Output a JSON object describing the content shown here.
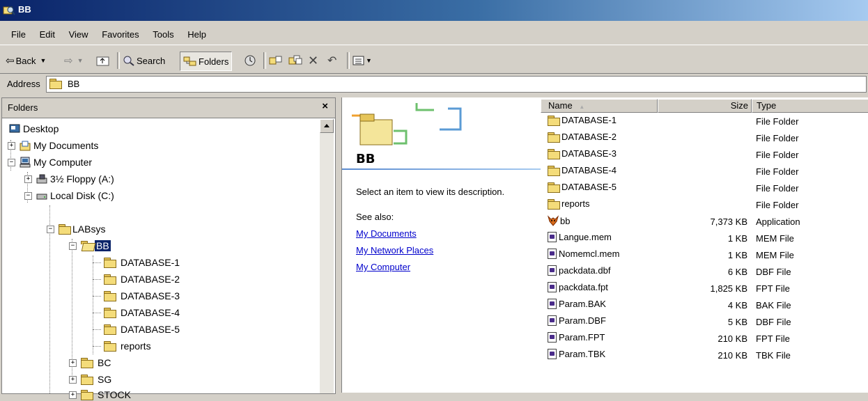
{
  "window": {
    "title": "BB"
  },
  "menu": [
    "File",
    "Edit",
    "View",
    "Favorites",
    "Tools",
    "Help"
  ],
  "toolbar": {
    "back_label": "Back",
    "search_label": "Search",
    "folders_label": "Folders"
  },
  "address": {
    "label": "Address",
    "value": "BB"
  },
  "folders_pane": {
    "title": "Folders",
    "close_glyph": "×",
    "tree": [
      {
        "label": "Desktop",
        "icon": "desktop-icon"
      },
      {
        "label": "My Documents",
        "icon": "my-documents-icon",
        "toggle": "+"
      },
      {
        "label": "My Computer",
        "icon": "my-computer-icon",
        "toggle": "−"
      },
      {
        "label": "3½ Floppy (A:)",
        "icon": "floppy-drive-icon",
        "toggle": "+"
      },
      {
        "label": "Local Disk (C:)",
        "icon": "hard-disk-icon",
        "toggle": "−"
      },
      {
        "label": "LABsys",
        "icon": "folder-icon",
        "toggle": "−"
      },
      {
        "label": "BB",
        "icon": "folder-open-icon",
        "toggle": "−",
        "selected": true
      },
      {
        "label": "DATABASE-1",
        "icon": "folder-icon"
      },
      {
        "label": "DATABASE-2",
        "icon": "folder-icon"
      },
      {
        "label": "DATABASE-3",
        "icon": "folder-icon"
      },
      {
        "label": "DATABASE-4",
        "icon": "folder-icon"
      },
      {
        "label": "DATABASE-5",
        "icon": "folder-icon"
      },
      {
        "label": "reports",
        "icon": "folder-icon"
      },
      {
        "label": "BC",
        "icon": "folder-icon",
        "toggle": "+"
      },
      {
        "label": "SG",
        "icon": "folder-icon",
        "toggle": "+"
      },
      {
        "label": "STOCK",
        "icon": "folder-icon",
        "toggle": "+"
      }
    ]
  },
  "web_view": {
    "folder_name": "BB",
    "description": "Select an item to view its description.",
    "see_also": "See also:",
    "links": [
      "My Documents",
      "My Network Places",
      "My Computer"
    ]
  },
  "list": {
    "columns": {
      "name": "Name",
      "size": "Size",
      "type": "Type"
    },
    "sort_glyph": "▲",
    "files": [
      {
        "name": "DATABASE-1",
        "size": "",
        "type": "File Folder",
        "icon": "folder-icon"
      },
      {
        "name": "DATABASE-2",
        "size": "",
        "type": "File Folder",
        "icon": "folder-icon"
      },
      {
        "name": "DATABASE-3",
        "size": "",
        "type": "File Folder",
        "icon": "folder-icon"
      },
      {
        "name": "DATABASE-4",
        "size": "",
        "type": "File Folder",
        "icon": "folder-icon"
      },
      {
        "name": "DATABASE-5",
        "size": "",
        "type": "File Folder",
        "icon": "folder-icon"
      },
      {
        "name": "reports",
        "size": "",
        "type": "File Folder",
        "icon": "folder-icon"
      },
      {
        "name": "bb",
        "size": "7,373 KB",
        "type": "Application",
        "icon": "foxpro-app-icon"
      },
      {
        "name": "Langue.mem",
        "size": "1 KB",
        "type": "MEM File",
        "icon": "file-icon"
      },
      {
        "name": "Nomemcl.mem",
        "size": "1 KB",
        "type": "MEM File",
        "icon": "file-icon"
      },
      {
        "name": "packdata.dbf",
        "size": "6 KB",
        "type": "DBF File",
        "icon": "file-icon"
      },
      {
        "name": "packdata.fpt",
        "size": "1,825 KB",
        "type": "FPT File",
        "icon": "file-icon"
      },
      {
        "name": "Param.BAK",
        "size": "4 KB",
        "type": "BAK File",
        "icon": "file-icon"
      },
      {
        "name": "Param.DBF",
        "size": "5 KB",
        "type": "DBF File",
        "icon": "file-icon"
      },
      {
        "name": "Param.FPT",
        "size": "210 KB",
        "type": "FPT File",
        "icon": "file-icon"
      },
      {
        "name": "Param.TBK",
        "size": "210 KB",
        "type": "TBK File",
        "icon": "file-icon"
      }
    ]
  },
  "colors": {
    "title_dark": "#0a246a",
    "title_light": "#a6caf0",
    "chrome": "#d4d0c8",
    "link": "#0000cc"
  }
}
